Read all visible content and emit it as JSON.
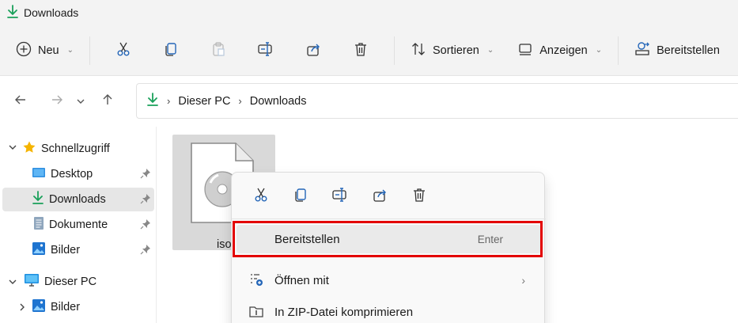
{
  "window": {
    "title": "Downloads"
  },
  "toolbar": {
    "new_label": "Neu",
    "sort_label": "Sortieren",
    "view_label": "Anzeigen",
    "share_label": "Bereitstellen"
  },
  "nav": {
    "breadcrumb": [
      "Dieser PC",
      "Downloads"
    ]
  },
  "sidebar": {
    "quick_access": "Schnellzugriff",
    "items": [
      {
        "label": "Desktop",
        "icon": "desktop-icon"
      },
      {
        "label": "Downloads",
        "icon": "download-icon"
      },
      {
        "label": "Dokumente",
        "icon": "document-icon"
      },
      {
        "label": "Bilder",
        "icon": "picture-icon"
      }
    ],
    "this_pc": "Dieser PC",
    "this_pc_items": [
      {
        "label": "Bilder",
        "icon": "picture-icon"
      }
    ]
  },
  "content": {
    "file_name_visible": "iso"
  },
  "context_menu": {
    "items": [
      {
        "label": "Bereitstellen",
        "shortcut": "Enter"
      },
      {
        "label": "Öffnen mit"
      },
      {
        "label": "In ZIP-Datei komprimieren"
      }
    ]
  },
  "colors": {
    "accent_download": "#19a05a",
    "highlight_box": "#e30000",
    "star": "#f5b400"
  }
}
